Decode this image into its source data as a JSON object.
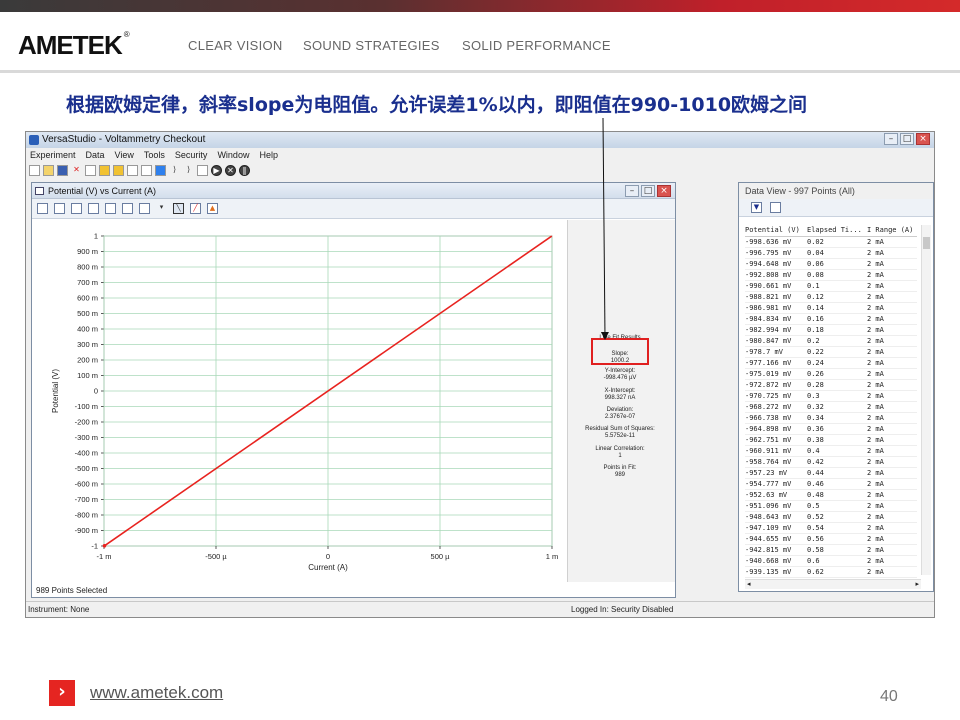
{
  "header": {
    "logo": "AMETEK",
    "logo_mark": "®",
    "taglines": [
      "CLEAR VISION",
      "SOUND STRATEGIES",
      "SOLID PERFORMANCE"
    ],
    "title": "根据欧姆定律，斜率slope为电阻值。允许误差1%以内，即阻值在990-1010欧姆之间"
  },
  "app": {
    "window_title": "VersaStudio - Voltammetry Checkout",
    "menu": [
      "Experiment",
      "Data",
      "View",
      "Tools",
      "Security",
      "Window",
      "Help"
    ],
    "status_left": "Instrument: None",
    "status_right": "Logged In: Security Disabled"
  },
  "plot_window": {
    "title": "Potential (V) vs Current (A)",
    "status": "989 Points Selected",
    "fit": {
      "heading": "Line Fit Results",
      "slope_label": "Slope:",
      "slope_value": "1000.2",
      "yint_label": "Y-Intercept:",
      "yint_value": "-998.476 µV",
      "xint_label": "X-Intercept:",
      "xint_value": "998.327 nA",
      "dev_label": "Deviation:",
      "dev_value": "2.3767e-07",
      "rss_label": "Residual Sum of Squares:",
      "rss_value": "5.5752e-11",
      "corr_label": "Linear Correlation:",
      "corr_value": "1",
      "pts_label": "Points in Fit:",
      "pts_value": "989"
    }
  },
  "chart_data": {
    "type": "line",
    "title": "",
    "xlabel": "Current (A)",
    "ylabel": "Potential (V)",
    "xlim": [
      -0.001,
      0.001
    ],
    "ylim": [
      -1,
      1
    ],
    "x_ticks": [
      -0.001,
      -0.0005,
      0,
      0.0005,
      0.001
    ],
    "x_tick_labels": [
      "-1 m",
      "-500 µ",
      "0",
      "500 µ",
      "1 m"
    ],
    "y_ticks": [
      1,
      0.9,
      0.8,
      0.7,
      0.6,
      0.5,
      0.4,
      0.3,
      0.2,
      0.1,
      0,
      -0.1,
      -0.2,
      -0.3,
      -0.4,
      -0.5,
      -0.6,
      -0.7,
      -0.8,
      -0.9,
      -1
    ],
    "y_tick_labels": [
      "1",
      "900 m",
      "800 m",
      "700 m",
      "600 m",
      "500 m",
      "400 m",
      "300 m",
      "200 m",
      "100 m",
      "0",
      "-100 m",
      "-200 m",
      "-300 m",
      "-400 m",
      "-500 m",
      "-600 m",
      "-700 m",
      "-800 m",
      "-900 m",
      "-1"
    ],
    "grid": true,
    "series": [
      {
        "x": [
          -0.000998,
          0.000999
        ],
        "y": [
          -0.9986,
          0.9996
        ],
        "color": "#e8231f"
      }
    ]
  },
  "data_view": {
    "title": "Data View - 997 Points (All)",
    "columns": [
      "Potential (V)",
      "Elapsed Ti...",
      "I Range (A)"
    ],
    "rows": [
      [
        "-998.636 mV",
        "0.02",
        "2 mA"
      ],
      [
        "-996.795 mV",
        "0.04",
        "2 mA"
      ],
      [
        "-994.648 mV",
        "0.06",
        "2 mA"
      ],
      [
        "-992.808 mV",
        "0.08",
        "2 mA"
      ],
      [
        "-990.661 mV",
        "0.1",
        "2 mA"
      ],
      [
        "-988.821 mV",
        "0.12",
        "2 mA"
      ],
      [
        "-986.981 mV",
        "0.14",
        "2 mA"
      ],
      [
        "-984.834 mV",
        "0.16",
        "2 mA"
      ],
      [
        "-982.994 mV",
        "0.18",
        "2 mA"
      ],
      [
        "-980.847 mV",
        "0.2",
        "2 mA"
      ],
      [
        "-978.7 mV",
        "0.22",
        "2 mA"
      ],
      [
        "-977.166 mV",
        "0.24",
        "2 mA"
      ],
      [
        "-975.019 mV",
        "0.26",
        "2 mA"
      ],
      [
        "-972.872 mV",
        "0.28",
        "2 mA"
      ],
      [
        "-970.725 mV",
        "0.3",
        "2 mA"
      ],
      [
        "-968.272 mV",
        "0.32",
        "2 mA"
      ],
      [
        "-966.738 mV",
        "0.34",
        "2 mA"
      ],
      [
        "-964.898 mV",
        "0.36",
        "2 mA"
      ],
      [
        "-962.751 mV",
        "0.38",
        "2 mA"
      ],
      [
        "-960.911 mV",
        "0.4",
        "2 mA"
      ],
      [
        "-958.764 mV",
        "0.42",
        "2 mA"
      ],
      [
        "-957.23 mV",
        "0.44",
        "2 mA"
      ],
      [
        "-954.777 mV",
        "0.46",
        "2 mA"
      ],
      [
        "-952.63 mV",
        "0.48",
        "2 mA"
      ],
      [
        "-951.096 mV",
        "0.5",
        "2 mA"
      ],
      [
        "-948.643 mV",
        "0.52",
        "2 mA"
      ],
      [
        "-947.109 mV",
        "0.54",
        "2 mA"
      ],
      [
        "-944.655 mV",
        "0.56",
        "2 mA"
      ],
      [
        "-942.815 mV",
        "0.58",
        "2 mA"
      ],
      [
        "-940.668 mV",
        "0.6",
        "2 mA"
      ],
      [
        "-939.135 mV",
        "0.62",
        "2 mA"
      ]
    ]
  },
  "footer": {
    "url": "www.ametek.com",
    "page": "40"
  },
  "colors": {
    "title_blue": "#1a2f8e",
    "accent_red": "#e52521",
    "series_red": "#e8231f",
    "grid_green": "#a8d8b8"
  }
}
